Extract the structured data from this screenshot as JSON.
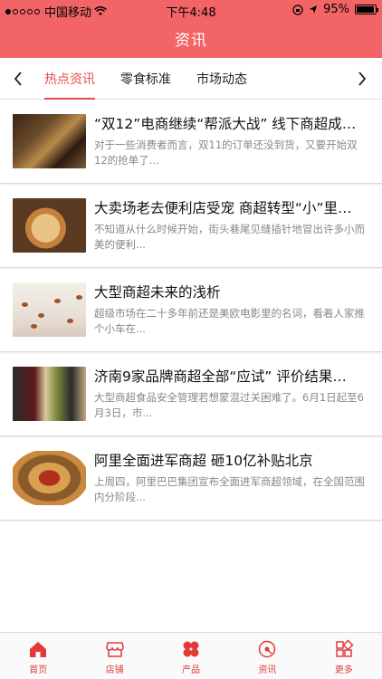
{
  "status_bar": {
    "carrier": "中国移动",
    "time": "下午4:48",
    "battery": "95%",
    "battery_level": 0.95
  },
  "header": {
    "title": "资讯"
  },
  "tabs": {
    "prev_icon": "chevron-left-icon",
    "next_icon": "chevron-right-icon",
    "items": [
      {
        "label": "热点资讯",
        "active": true
      },
      {
        "label": "零食标准",
        "active": false
      },
      {
        "label": "市场动态",
        "active": false
      }
    ]
  },
  "articles": [
    {
      "title": "“双12”电商继续“帮派大战” 线下商超成…",
      "summary": "对于一些消费者而言，双11的订单还没到货，又要开始双12的抢单了..."
    },
    {
      "title": "大卖场老去便利店受宠 商超转型“小”里…",
      "summary": "不知道从什么时候开始，街头巷尾见缝插针地冒出许多小而美的便利..."
    },
    {
      "title": "大型商超未来的浅析",
      "summary": "超级市场在二十多年前还是美欧电影里的名词，看着人家推个小车在..."
    },
    {
      "title": "济南9家品牌商超全部“应试” 评价结果…",
      "summary": "大型商超食品安全管理若想蒙混过关困难了。6月1日起至6月3日，市..."
    },
    {
      "title": "阿里全面进军商超 砸10亿补贴北京",
      "summary": "上周四，阿里巴巴集团宣布全面进军商超领域，在全国范围内分阶段..."
    }
  ],
  "bottom_nav": {
    "accent": "#e23a3a",
    "items": [
      {
        "label": "首页",
        "icon": "home-icon"
      },
      {
        "label": "店铺",
        "icon": "store-icon"
      },
      {
        "label": "产品",
        "icon": "product-icon"
      },
      {
        "label": "资讯",
        "icon": "news-icon"
      },
      {
        "label": "更多",
        "icon": "more-icon"
      }
    ]
  }
}
